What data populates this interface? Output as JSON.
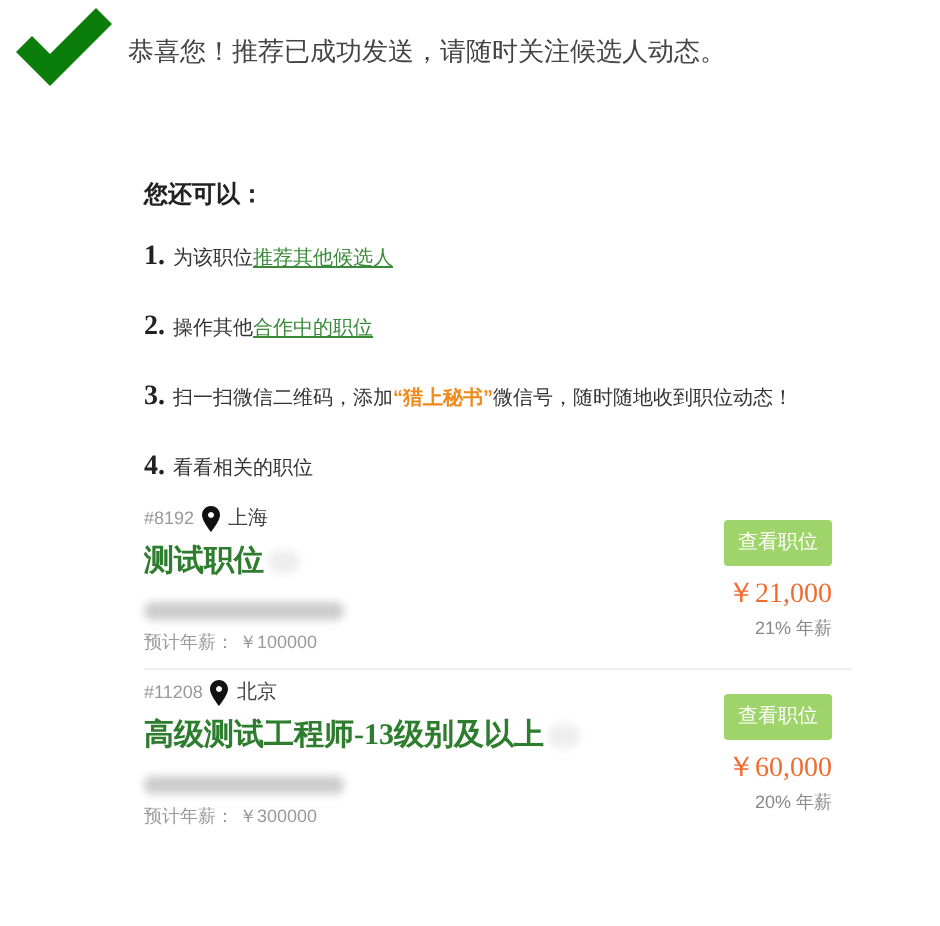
{
  "message": "恭喜您！推荐已成功发送，请随时关注候选人动态。",
  "subheading": "您还可以：",
  "steps": [
    {
      "number": "1.",
      "parts": [
        {
          "kind": "text",
          "text": "为该职位"
        },
        {
          "kind": "link",
          "text": "推荐其他候选人"
        }
      ]
    },
    {
      "number": "2.",
      "parts": [
        {
          "kind": "text",
          "text": "操作其他"
        },
        {
          "kind": "link",
          "text": "合作中的职位"
        }
      ]
    },
    {
      "number": "3.",
      "parts": [
        {
          "kind": "text",
          "text": "扫一扫微信二维码，添加"
        },
        {
          "kind": "highlight",
          "text": "“猎上秘书”"
        },
        {
          "kind": "text",
          "text": "微信号，随时随地收到职位动态！"
        }
      ]
    },
    {
      "number": "4.",
      "parts": [
        {
          "kind": "text",
          "text": "看看相关的职位"
        }
      ]
    }
  ],
  "jobs": [
    {
      "id": "#8192",
      "city": "上海",
      "title": "测试职位",
      "button": "查看职位",
      "reward": "￥21,000",
      "rate": "21% 年薪",
      "salary": "预计年薪： ￥100000"
    },
    {
      "id": "#11208",
      "city": "北京",
      "title": "高级测试工程师-13级别及以上",
      "button": "查看职位",
      "reward": "￥60,000",
      "rate": "20% 年薪",
      "salary": "预计年薪： ￥300000"
    }
  ]
}
